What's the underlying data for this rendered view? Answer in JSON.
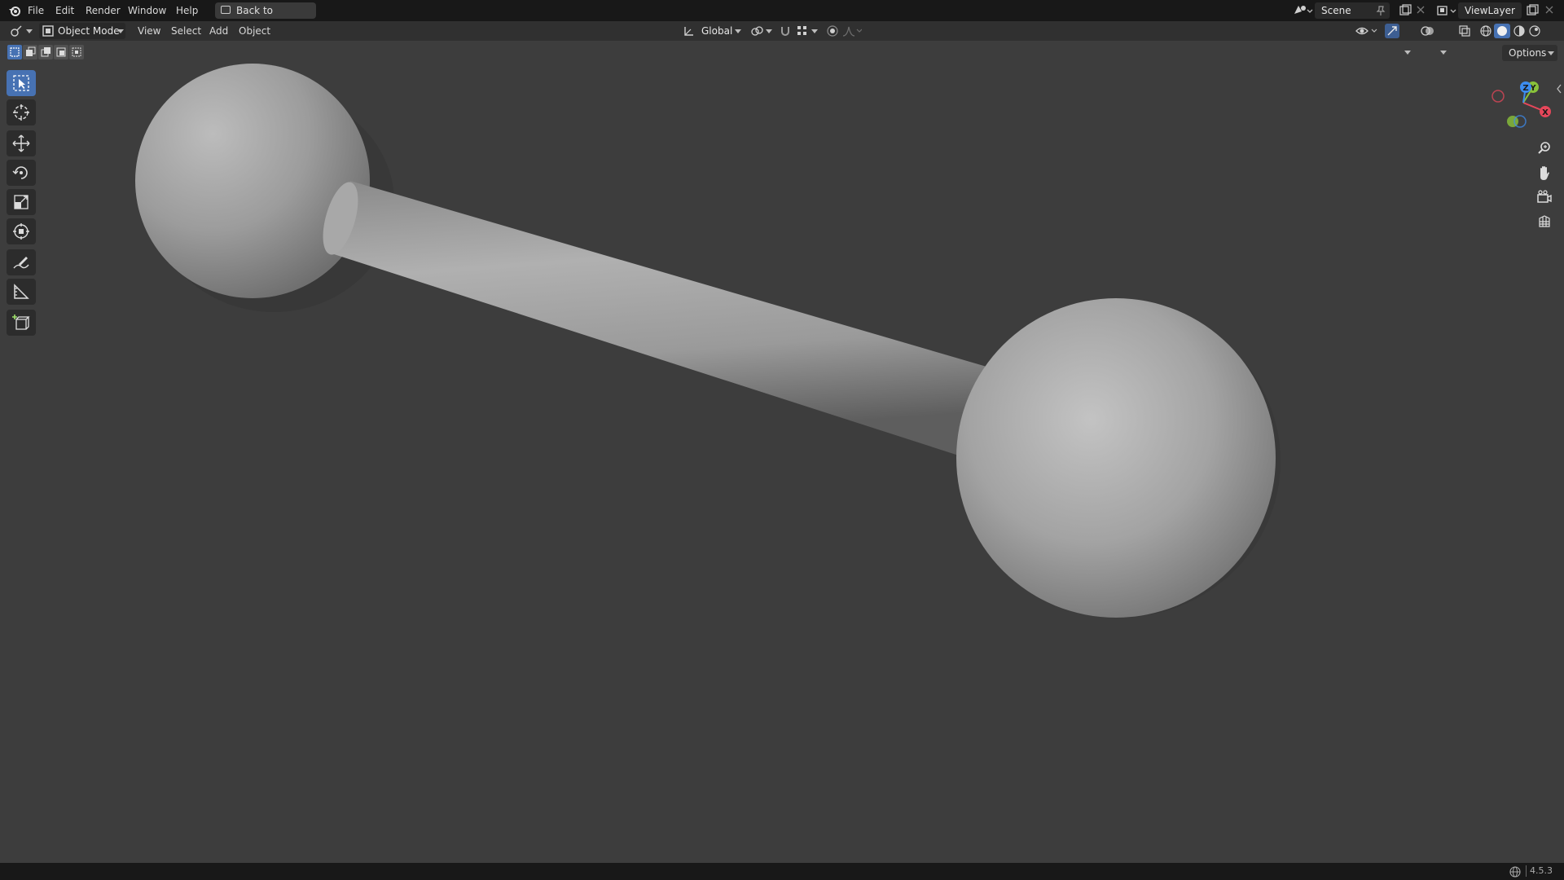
{
  "menu": {
    "items": [
      "File",
      "Edit",
      "Render",
      "Window",
      "Help"
    ],
    "back_label": "Back to Previous"
  },
  "scene": {
    "value": "Scene"
  },
  "view_layer": {
    "value": "ViewLayer"
  },
  "header": {
    "mode": "Object Mode",
    "menus": [
      "View",
      "Select",
      "Add",
      "Object"
    ],
    "transform_orientation": "Global",
    "options": "Options"
  },
  "gizmo": {
    "x": "X",
    "y": "Y",
    "z": "Z"
  },
  "status": {
    "version": "4.5.3"
  },
  "colors": {
    "accent": "#4772b3",
    "axis_x": "#e6475a",
    "axis_y": "#89c23a",
    "axis_z": "#3d8cef",
    "viewport_bg": "#3d3d3d"
  },
  "icons": [
    "blender-logo-icon",
    "editor-type-icon",
    "object-mode-icon",
    "transform-orientation-icon",
    "pivot-icon",
    "snap-icon",
    "proportional-edit-icon",
    "visibility-icon",
    "gizmo-icon",
    "overlay-icon",
    "xray-icon",
    "wireframe-shading-icon",
    "solid-shading-icon",
    "material-shading-icon",
    "rendered-shading-icon",
    "select-box-icon",
    "cursor-icon",
    "move-icon",
    "rotate-icon",
    "scale-icon",
    "transform-icon",
    "annotate-icon",
    "measure-icon",
    "add-cube-icon",
    "zoom-icon",
    "pan-icon",
    "camera-view-icon",
    "ortho-toggle-icon",
    "network-icon"
  ]
}
